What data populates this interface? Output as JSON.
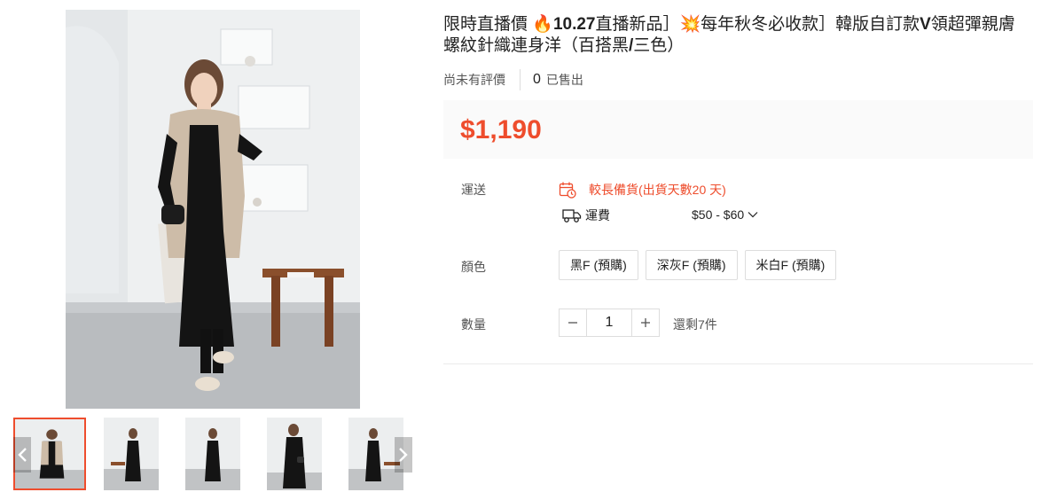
{
  "product": {
    "title_part1": "限時直播價 🔥",
    "title_bold1": "10.27",
    "title_part2": "直播新品］💥每年秋冬必收款］韓版自訂款",
    "title_bold2": "V",
    "title_part3": "領超彈親膚螺紋針織連身洋（百搭黑",
    "title_bold3": "/",
    "title_part4": "三色）",
    "no_review": "尚未有評價",
    "sold_count": "0",
    "sold_label": "已售出",
    "price": "$1,190"
  },
  "shipping": {
    "label": "運送",
    "warning": "較長備貨(出貨天數20 天)",
    "fee_label": "運費",
    "fee_value": "$50 - $60"
  },
  "color": {
    "label": "顏色",
    "options": [
      "黑F (預購)",
      "深灰F (預購)",
      "米白F (預購)"
    ]
  },
  "quantity": {
    "label": "數量",
    "value": "1",
    "stock": "還剩7件"
  },
  "gallery": {
    "active_index": 0,
    "thumbnail_count": 5
  },
  "colors": {
    "accent": "#ee4d2d",
    "text": "#222222",
    "muted": "#555555",
    "border": "#dddddd"
  },
  "icons": {
    "calendar": "calendar-clock-icon",
    "truck": "truck-icon",
    "chevron": "chevron-down-icon",
    "minus": "minus-icon",
    "plus": "plus-icon",
    "prev": "chevron-left-icon",
    "next": "chevron-right-icon"
  }
}
